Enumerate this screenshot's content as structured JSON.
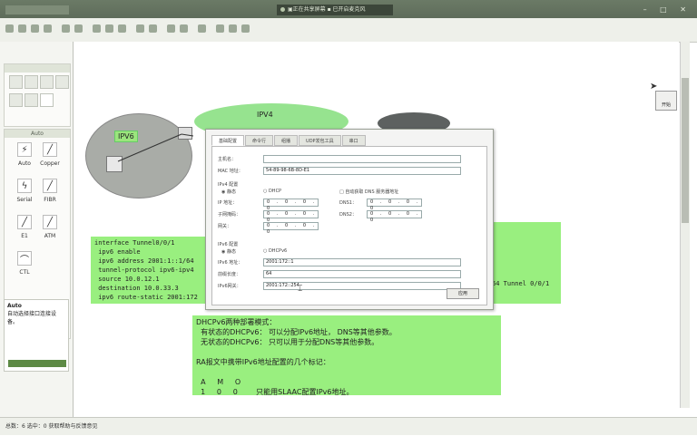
{
  "window": {
    "title": "▣正在共享屏幕 ▪ 已开启麦克风",
    "controls": "– □ ✕"
  },
  "left_panel": {
    "connections": [
      {
        "label": "Auto",
        "icon": "lightning-icon"
      },
      {
        "label": "Copper",
        "icon": "straight-cable-icon"
      },
      {
        "label": "Serial",
        "icon": "serial-cable-icon"
      },
      {
        "label": "FIBR",
        "icon": "fiber-icon"
      },
      {
        "label": "E1",
        "icon": "e1-icon"
      },
      {
        "label": "ATM",
        "icon": "atm-icon"
      },
      {
        "label": "CTL",
        "icon": "console-icon"
      }
    ],
    "auto_box": {
      "title": "Auto",
      "text": "自动选择接口连接设备。"
    }
  },
  "canvas": {
    "label_ipv6": "IPV6",
    "label_ipv4": "IPV4",
    "code_left": "interface Tunnel0/0/1\n ipv6 enable\n ipv6 address 2001:1::1/64\n tunnel-protocol ipv6-ipv4\n source 10.0.12.1\n destination 10.0.33.3\n ipv6 route-static 2001:172",
    "code_right": "64 Tunnel 0/0/1",
    "notes": "DHCPv6两种部署模式：\n  有状态的DHCPv6： 可以分配IPv6地址， DNS等其他参数。\n  无状态的DHCPv6： 只可以用于分配DNS等其他参数。\n\nRA报文中携带IPv6地址配置的几个标记：\n\n  A     M     O\n  1     0     0        只能用SLAAC配置IPv6地址。",
    "topright_label": "开始"
  },
  "dialog": {
    "tabs": [
      "基础配置",
      "命令行",
      "组播",
      "UDP发包工具",
      "串口"
    ],
    "active_tab": 0,
    "host_label": "主机名：",
    "host_value": "",
    "mac_label": "MAC 地址：",
    "mac_value": "54-89-98-6B-8D-E1",
    "ipv4_section": "IPv4 配置",
    "ipv4_static": "静态",
    "ipv4_dhcp": "DHCP",
    "ipv4_auto_dns": "自动获取 DNS 服务器地址",
    "ip_label": "IP 地址：",
    "ip_value": "0 . 0 . 0 . 0",
    "mask_label": "子网掩码：",
    "mask_value": "0 . 0 . 0 . 0",
    "gw_label": "网关：",
    "gw_value": "0 . 0 . 0 . 0",
    "dns1_label": "DNS1：",
    "dns1_value": "0 . 0 . 0 . 0",
    "dns2_label": "DNS2：",
    "dns2_value": "0 . 0 . 0 . 0",
    "ipv6_section": "IPv6 配置",
    "ipv6_static": "静态",
    "ipv6_dhcp": "DHCPv6",
    "ipv6_addr_label": "IPv6 地址：",
    "ipv6_addr_value": "2001:172::1",
    "prefix_label": "前缀长度：",
    "prefix_value": "64",
    "ipv6_gw_label": "IPv6网关：",
    "ipv6_gw_value": "2001:172::254",
    "ok_label": "应用"
  },
  "statusbar": {
    "text": "总数：6 选中：0   获取帮助与反馈意见"
  },
  "colors": {
    "green_note": "#99ef7f",
    "titlebar": "#4e5a4b"
  }
}
